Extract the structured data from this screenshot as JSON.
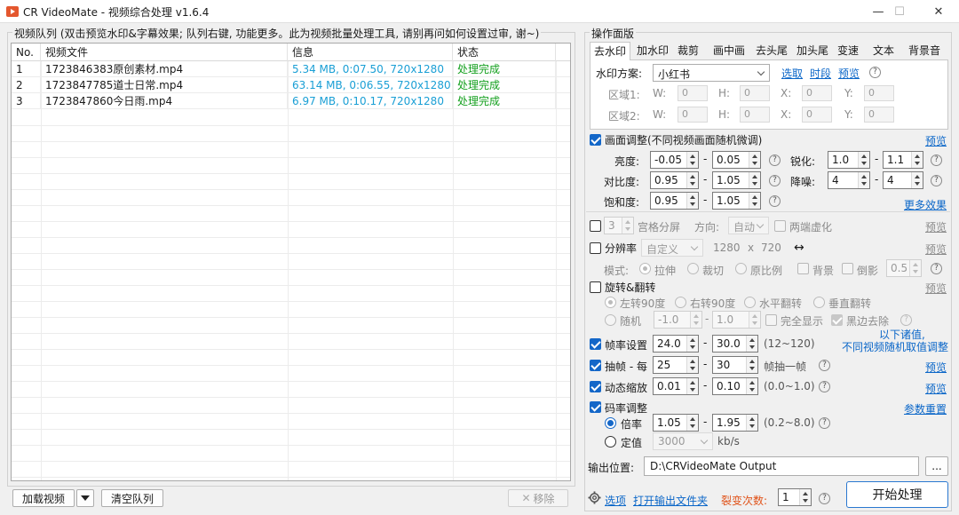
{
  "window": {
    "title": "CR VideoMate - 视频综合处理 v1.6.4",
    "minimize": "—",
    "maximize": "☐",
    "close": "✕"
  },
  "queue": {
    "group_label": "视频队列 (双击预览水印&字幕效果; 队列右键, 功能更多。此为视频批量处理工具, 请别再问如何设置过审, 谢~)",
    "columns": [
      "No.",
      "视频文件",
      "信息",
      "状态"
    ],
    "rows": [
      {
        "no": "1",
        "file": "1723846383原创素材.mp4",
        "info": "5.34 MB, 0:07.50, 720x1280",
        "status": "处理完成"
      },
      {
        "no": "2",
        "file": "1723847785道士日常.mp4",
        "info": "63.14 MB, 0:06.55, 720x1280",
        "status": "处理完成"
      },
      {
        "no": "3",
        "file": "1723847860今日雨.mp4",
        "info": "6.97 MB, 0:10.17, 720x1280",
        "status": "处理完成"
      }
    ],
    "load_button": "加载视频",
    "clear_button": "清空队列",
    "remove_button": "移除"
  },
  "panel": {
    "group_label": "操作面版",
    "tabs": [
      "去水印",
      "加水印",
      "裁剪",
      "画中画",
      "去头尾",
      "加头尾",
      "变速",
      "文本",
      "背景音"
    ],
    "watermark": {
      "scheme_label": "水印方案:",
      "scheme_value": "小红书",
      "pick": "选取",
      "timeline": "时段",
      "preview": "预览",
      "area1": "区域1:",
      "area2": "区域2:",
      "w": "W:",
      "h": "H:",
      "x": "X:",
      "y": "Y:",
      "zero": "0"
    },
    "adjust": {
      "label": "画面调整(不同视频画面随机微调)",
      "preview": "预览",
      "brightness": "亮度:",
      "b_min": "-0.05",
      "b_max": "0.05",
      "contrast": "对比度:",
      "c_min": "0.95",
      "c_max": "1.05",
      "saturation": "饱和度:",
      "s_min": "0.95",
      "s_max": "1.05",
      "sharpen": "锐化:",
      "sh_min": "1.0",
      "sh_max": "1.1",
      "denoise": "降噪:",
      "d_min": "4",
      "d_max": "4",
      "more": "更多效果",
      "dash": "-"
    },
    "grid": {
      "count": "3",
      "label": "宫格分屏",
      "direction": "方向:",
      "direction_value": "自动",
      "blur": "两端虚化",
      "preview": "预览"
    },
    "resolution": {
      "label": "分辨率",
      "preset": "自定义",
      "width": "1280",
      "x": "x",
      "height": "720",
      "swap": "↔",
      "preview": "预览",
      "mode": "模式:",
      "stretch": "拉伸",
      "crop": "裁切",
      "ratio": "原比例",
      "bg": "背景",
      "shadow": "倒影",
      "shadow_value": "0.5"
    },
    "rotate": {
      "label": "旋转&翻转",
      "preview": "预览",
      "left90": "左转90度",
      "right90": "右转90度",
      "hflip": "水平翻转",
      "vflip": "垂直翻转",
      "random": "随机",
      "r_min": "-1.0",
      "r_max": "1.0",
      "full": "完全显示",
      "black": "黑边去除"
    },
    "note": {
      "line1": "以下诸值,",
      "line2": "不同视频随机取值调整"
    },
    "fps": {
      "label": "帧率设置",
      "min": "24.0",
      "max": "30.0",
      "range": "(12~120)"
    },
    "drop": {
      "label": "抽帧 - 每",
      "min": "25",
      "max": "30",
      "suffix": "帧抽一帧",
      "preview": "预览"
    },
    "zoom": {
      "label": "动态缩放",
      "min": "0.01",
      "max": "0.10",
      "range": "(0.0~1.0)",
      "preview": "预览"
    },
    "bitrate": {
      "label": "码率调整",
      "reset": "参数重置",
      "ratio": "倍率",
      "ratio_min": "1.05",
      "ratio_max": "1.95",
      "ratio_range": "(0.2~8.0)",
      "fixed": "定值",
      "fixed_value": "3000",
      "unit": "kb/s"
    },
    "output": {
      "label": "输出位置:",
      "path": "D:\\CRVideoMate Output",
      "browse": "..."
    },
    "footer": {
      "options": "选项",
      "open_folder": "打开输出文件夹",
      "split_label": "裂变次数:",
      "split_value": "1",
      "start": "开始处理"
    }
  }
}
